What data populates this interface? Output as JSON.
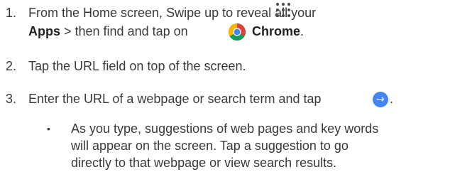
{
  "steps": [
    {
      "number": "1.",
      "line1": "From the Home screen, Swipe up to reveal all your",
      "line2_bold_apps": "Apps",
      "line2_mid": " > then find and tap on",
      "line2_bold_chrome": "Chrome",
      "line2_end": "."
    },
    {
      "number": "2.",
      "text": "Tap the URL field on top of the screen."
    },
    {
      "number": "3.",
      "text": "Enter the URL of a webpage or search term and tap",
      "text_end": "."
    }
  ],
  "bullet": {
    "symbol": "•",
    "line1": "As you type, suggestions of web pages and key words",
    "line2": "will appear on the screen. Tap a suggestion to go",
    "line3": "directly to that webpage or view search results."
  },
  "icons": {
    "apps": "apps-grid-icon",
    "chrome": "chrome-icon",
    "go": "go-arrow-icon",
    "go_glyph": "→"
  },
  "colors": {
    "text": "#3a3a3a",
    "go_button": "#4285f4",
    "chrome_red": "#db4437",
    "chrome_yellow": "#f4b400",
    "chrome_green": "#0f9d58",
    "chrome_blue": "#4285f4"
  }
}
